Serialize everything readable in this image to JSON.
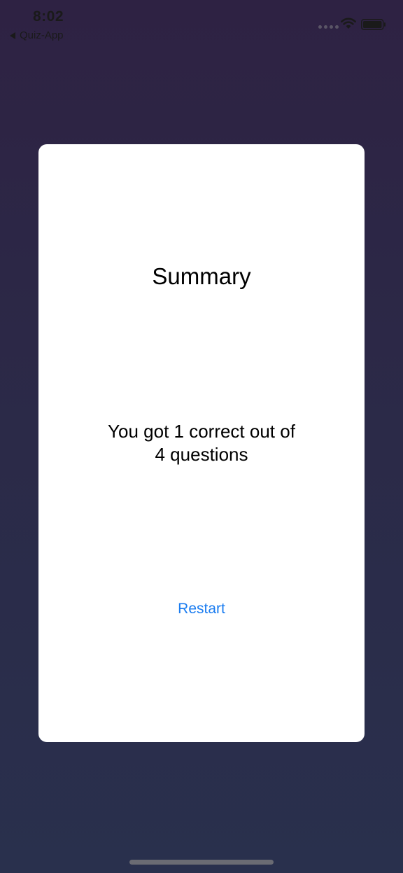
{
  "status_bar": {
    "time": "8:02",
    "back_label": "Quiz-App"
  },
  "card": {
    "title": "Summary",
    "score_line1": "You got 1 correct out of",
    "score_line2": "4 questions",
    "restart_label": "Restart"
  },
  "colors": {
    "background_top": "#2e2243",
    "background_bottom": "#29304d",
    "card": "#ffffff",
    "link": "#1a7cf0"
  },
  "icons": [
    "signal-icon",
    "wifi-icon",
    "battery-icon",
    "back-arrow-icon"
  ]
}
